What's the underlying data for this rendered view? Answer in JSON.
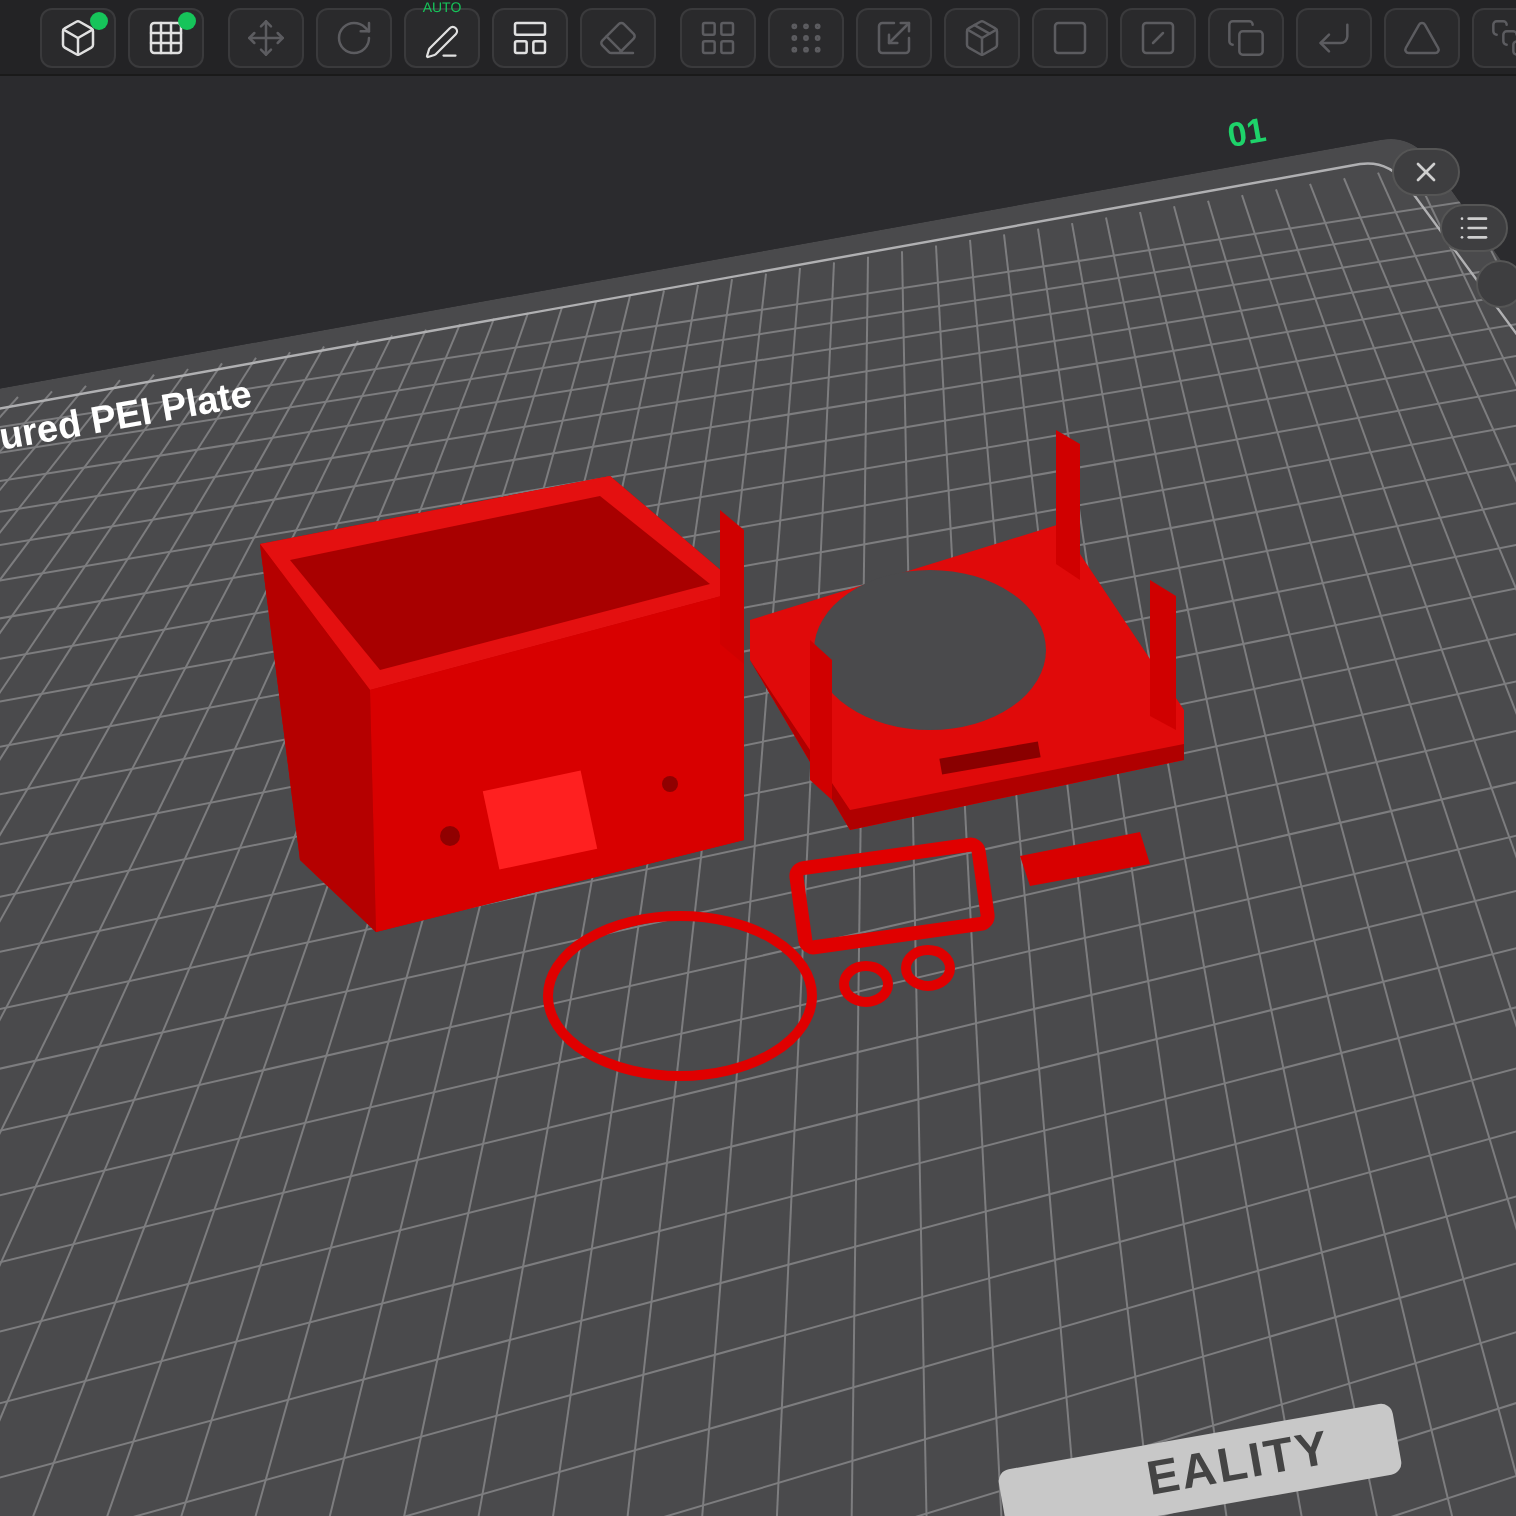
{
  "toolbar": {
    "auto_label": "AUTO"
  },
  "plate": {
    "number": "01",
    "name": "ured PEI Plate",
    "brand": "EALITY"
  }
}
